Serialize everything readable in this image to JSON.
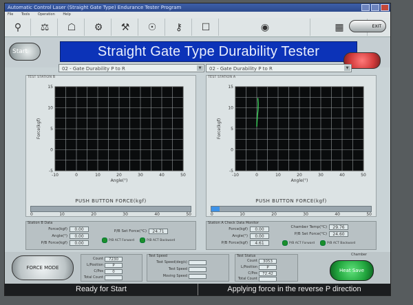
{
  "window": {
    "title": "Automatic Control Laser (Straight Gate Type) Endurance Tester Program"
  },
  "menu": [
    "File",
    "Tools",
    "Operation",
    "Help"
  ],
  "toolbar": {
    "icons": [
      "probe-icon",
      "scale-icon",
      "lamp-icon",
      "gear-icon",
      "tool-icon",
      "sensor-icon",
      "wrench-icon",
      "doc-icon",
      "globe-icon",
      "chart-icon"
    ],
    "exit_label": "EXIT"
  },
  "header": {
    "start_label": "Start",
    "banner": "Straight Gate Type Durability Tester"
  },
  "stations": [
    {
      "title": "TEST STATION B",
      "combo": "02 - Gate Durability P to R",
      "pushbutton_title": "PUSH BUTTON FORCE(kgf)",
      "pb_fill_percent": 0,
      "pb_ticks": [
        "0",
        "10",
        "20",
        "30",
        "40",
        "50"
      ]
    },
    {
      "title": "TEST STATION A",
      "combo": "02 - Gate Durability P to R",
      "pushbutton_title": "PUSH BUTTON FORCE(kgf)",
      "pb_fill_percent": 5,
      "pb_ticks": [
        "0",
        "10",
        "20",
        "30",
        "40",
        "50"
      ]
    }
  ],
  "chart_data": [
    {
      "type": "line",
      "xlabel": "Angle(°)",
      "ylabel": "Force(kgf)",
      "xlim": [
        -10,
        50
      ],
      "ylim": [
        -5,
        15
      ],
      "x_ticks": [
        "-10",
        "0",
        "10",
        "20",
        "30",
        "40",
        "50"
      ],
      "y_ticks": [
        "15",
        "10",
        "5",
        "0",
        "-5"
      ],
      "grid": true,
      "series": []
    },
    {
      "type": "line",
      "xlabel": "Angle(°)",
      "ylabel": "Force(kgf)",
      "xlim": [
        -10,
        50
      ],
      "ylim": [
        -5,
        15
      ],
      "x_ticks": [
        "-10",
        "0",
        "10",
        "20",
        "30",
        "40",
        "50"
      ],
      "y_ticks": [
        "15",
        "10",
        "5",
        "0",
        "-5"
      ],
      "grid": true,
      "series": [
        {
          "color": "#3ad25a",
          "x": [
            0.5,
            0.7,
            0.6,
            0.3,
            0.1,
            0.0
          ],
          "y": [
            12.3,
            11.0,
            9.5,
            8.0,
            6.5,
            5.5
          ]
        }
      ]
    }
  ],
  "info_left": {
    "title": "Station B Data",
    "rows": [
      {
        "label": "Force(kgf)",
        "value": "0.00"
      },
      {
        "label": "Angle(°)",
        "value": "0.00"
      },
      {
        "label": "P/B Force(kgf)",
        "value": "0.00"
      }
    ],
    "right_rows": [
      {
        "label": "P/B Set Force(°C)",
        "value": "24.71"
      }
    ],
    "leds": [
      "P/B ACT Forward",
      "P/B ACT Backward"
    ]
  },
  "info_right": {
    "title": "Station A Check Data Monitor",
    "rows": [
      {
        "label": "Force(kgf)",
        "value": "0.00"
      },
      {
        "label": "Angle(°)",
        "value": "0.00"
      },
      {
        "label": "P/B Force(kgf)",
        "value": "4.61"
      }
    ],
    "right_rows": [
      {
        "label": "Chamber Temp(°C)",
        "value": "29.76"
      },
      {
        "label": "P/B Set Force(°C)",
        "value": "24.60"
      }
    ],
    "leds": [
      "P/B ACT Forward",
      "P/B ACT Backward"
    ]
  },
  "bottom": {
    "force_mode_label": "FORCE MODE",
    "box_b": {
      "rows": [
        {
          "label": "Count",
          "value": "7230"
        },
        {
          "label": "L/Position",
          "value": "P"
        },
        {
          "label": "C/Pos",
          "value": "0"
        },
        {
          "label": "Total Count",
          "value": ""
        }
      ]
    },
    "box_mid": {
      "title": "Test Speed",
      "rows": [
        {
          "label": "Test Speed(deg/s)",
          "value": ""
        },
        {
          "label": "Test Speed",
          "value": ""
        },
        {
          "label": "Moving Speed",
          "value": ""
        }
      ]
    },
    "box_a": {
      "title": "Test Status",
      "rows": [
        {
          "label": "Count",
          "value": "3053"
        },
        {
          "label": "L/Position",
          "value": "P"
        },
        {
          "label": "C/Pos",
          "value": "72.42"
        },
        {
          "label": "Total Count",
          "value": ""
        }
      ]
    },
    "chamber_label": "Chamber",
    "chamber_button": "Heat Save"
  },
  "status": {
    "left": "Ready for Start",
    "right": "Applying force in the reverse P direction"
  }
}
